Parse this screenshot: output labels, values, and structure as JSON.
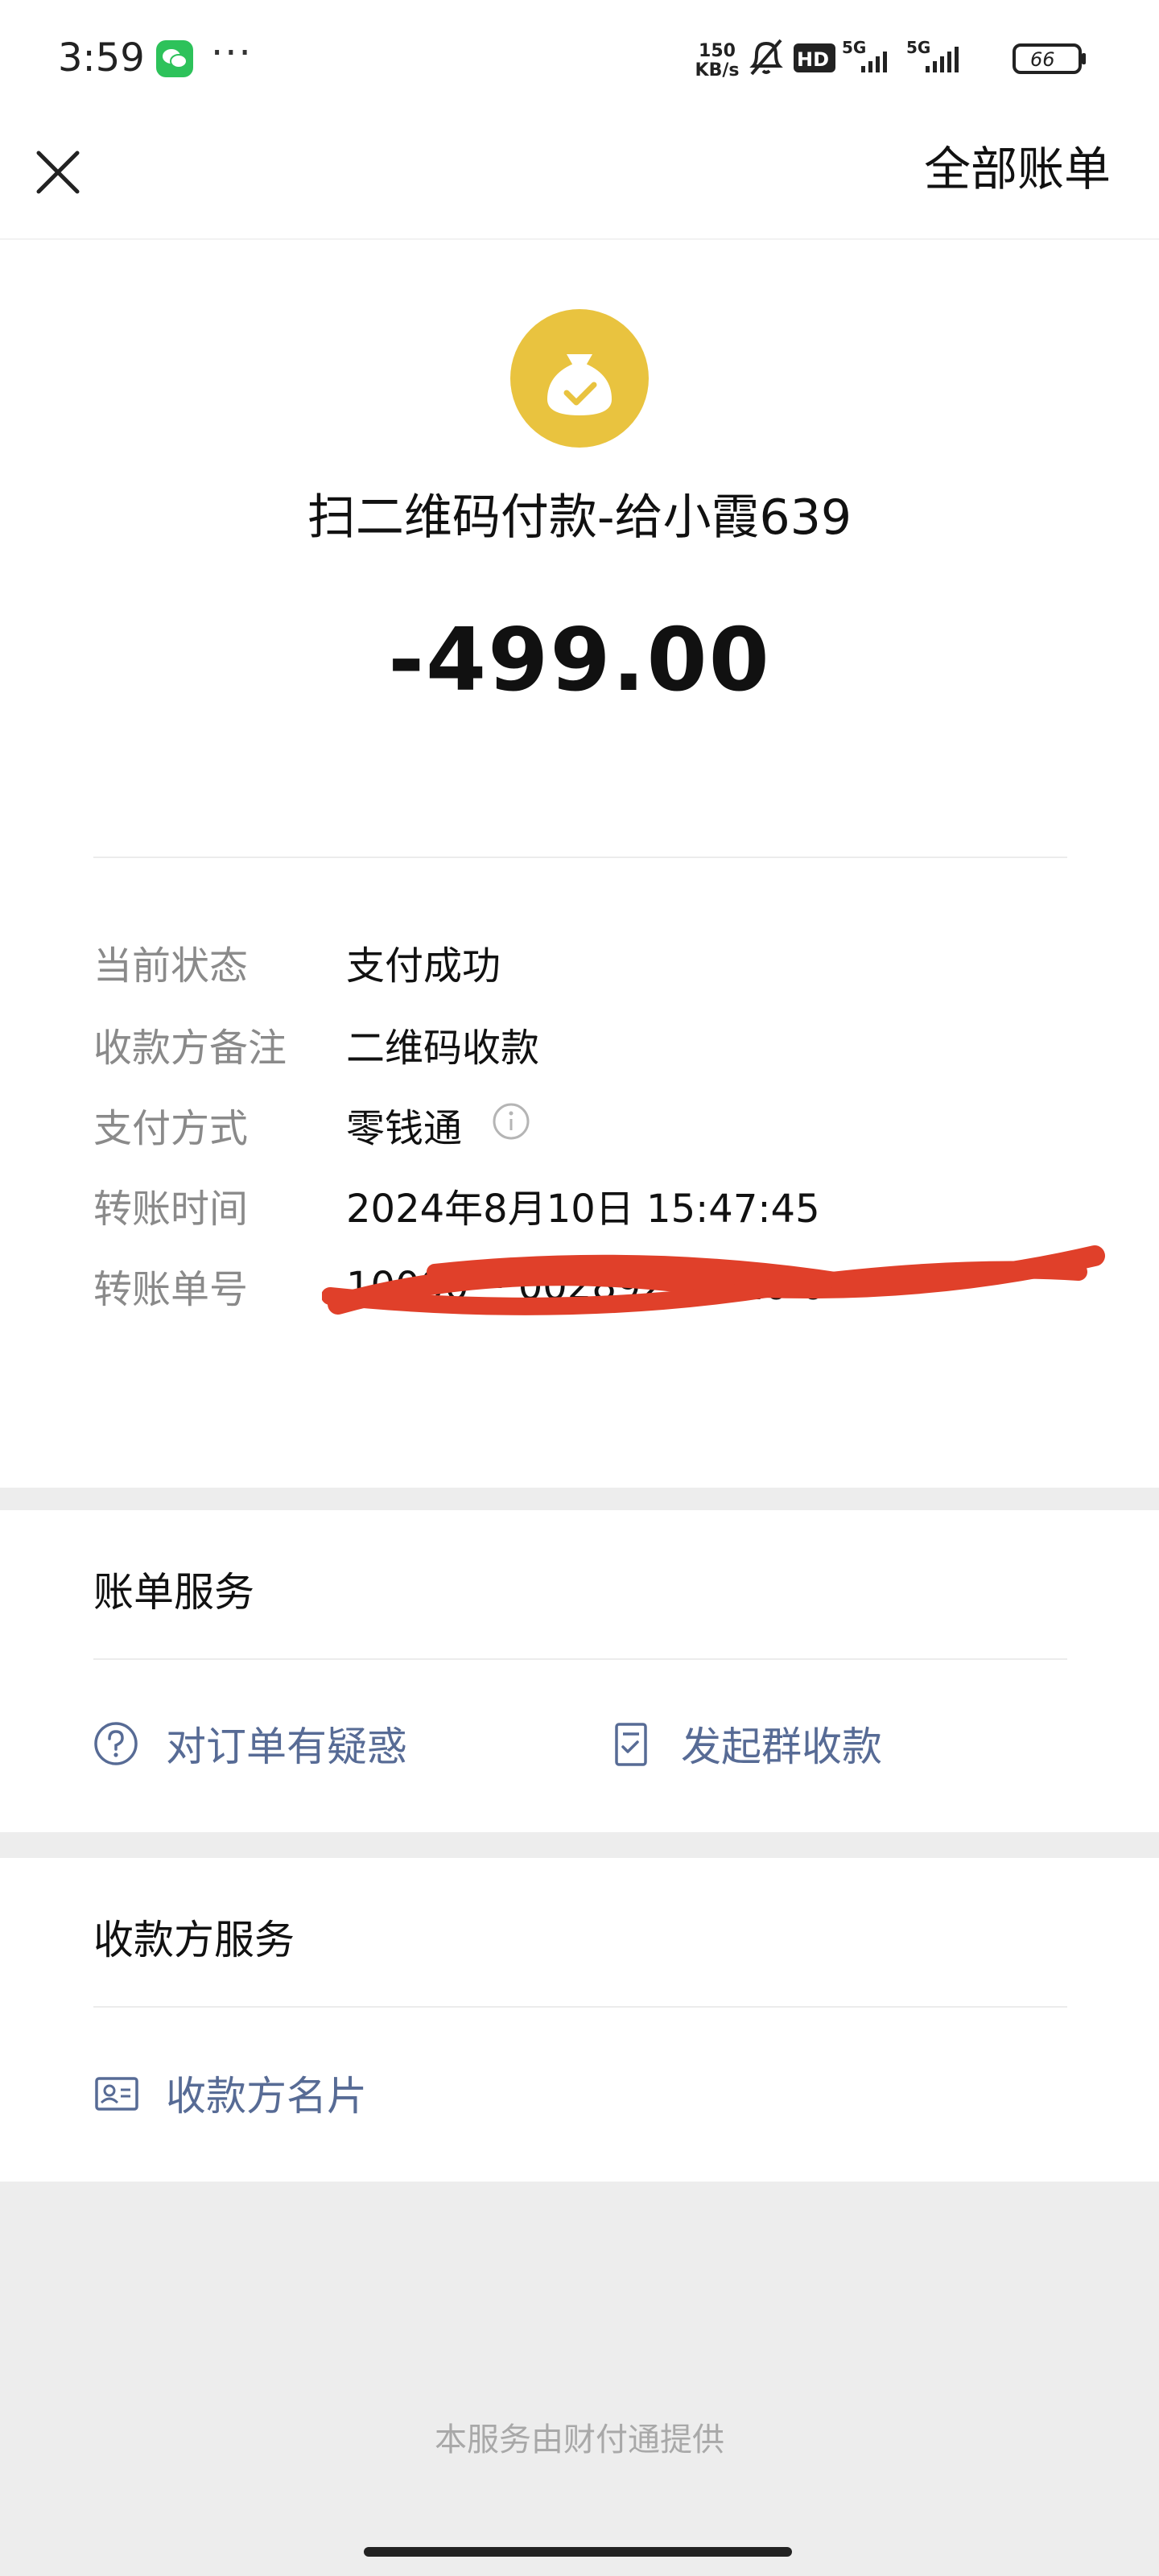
{
  "status_bar": {
    "time": "3:59",
    "dots": "···",
    "net_speed_value": "150",
    "net_speed_unit": "KB/s",
    "hd_label": "HD",
    "network_1": "5G",
    "network_2": "5G",
    "battery": "66",
    "icons": [
      "wechat-icon",
      "silent-bell-icon",
      "hd-icon",
      "signal-icon",
      "signal-icon",
      "battery-icon"
    ]
  },
  "header": {
    "close_icon": "close-icon",
    "all_bills_label": "全部账单"
  },
  "transaction": {
    "icon": "money-bag-icon",
    "icon_color": "#e9c33f",
    "title": "扫二维码付款-给小霞639",
    "amount": "-499.00",
    "details": [
      {
        "label": "当前状态",
        "value": "支付成功"
      },
      {
        "label": "收款方备注",
        "value": "二维码收款"
      },
      {
        "label": "支付方式",
        "value": "零钱通"
      },
      {
        "label": "转账时间",
        "value": "2024年8月10日 15:47:45"
      },
      {
        "label": "转账单号",
        "value": "10000 ·· 0028923 ·· 10 0"
      }
    ]
  },
  "bill_services": {
    "title": "账单服务",
    "links": [
      {
        "label": "对订单有疑惑",
        "icon": "question-circle-icon"
      },
      {
        "label": "发起群收款",
        "icon": "document-check-icon"
      }
    ]
  },
  "payee_services": {
    "title": "收款方服务",
    "links": [
      {
        "label": "收款方名片",
        "icon": "contact-card-icon"
      }
    ]
  },
  "footer": {
    "note": "本服务由财付通提供"
  },
  "colors": {
    "link": "#576b95",
    "label": "#8a8a8a",
    "background": "#ededed",
    "redaction": "#e0402a"
  }
}
